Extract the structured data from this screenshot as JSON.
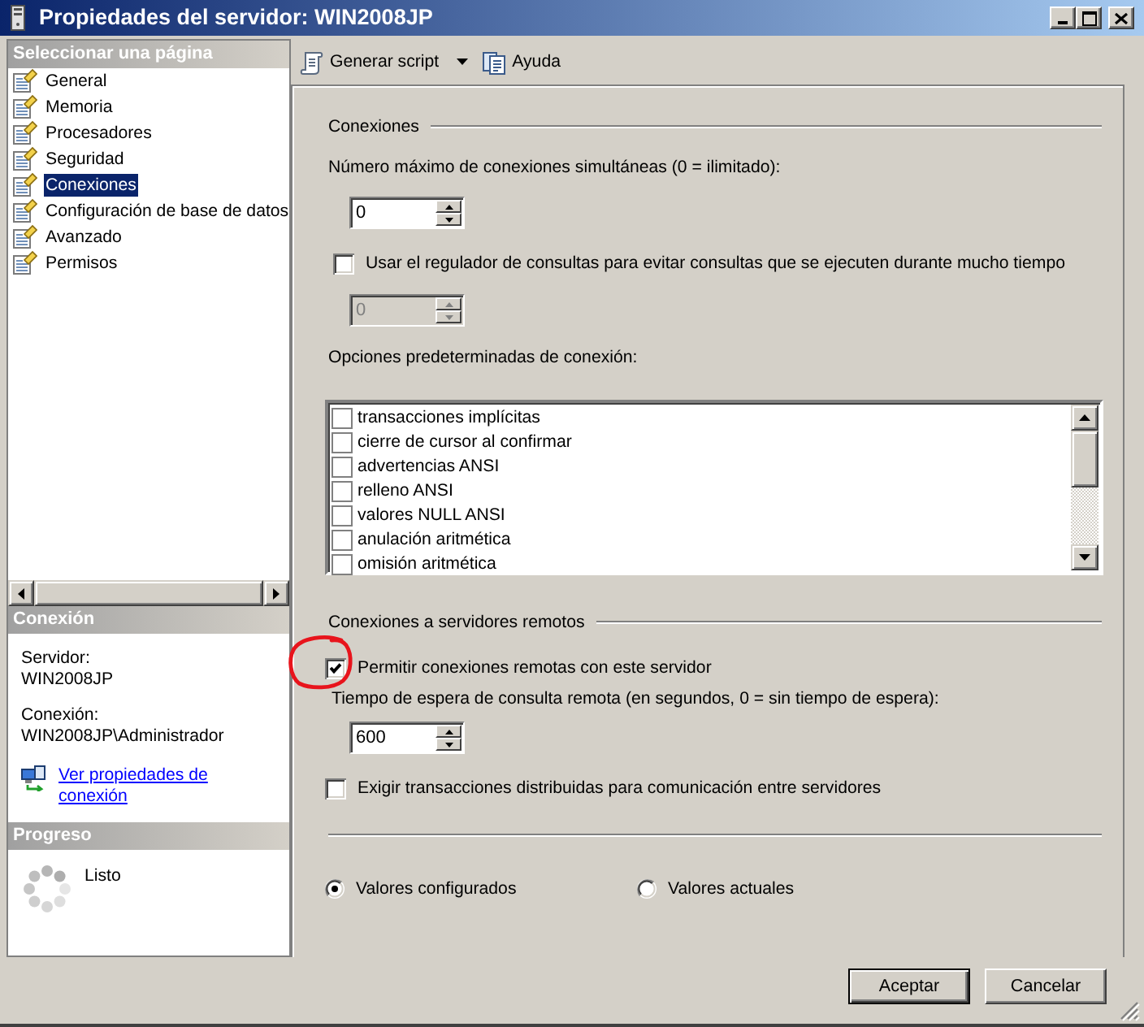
{
  "window": {
    "title": "Propiedades del servidor: WIN2008JP"
  },
  "page_selector": {
    "title": "Seleccionar una página",
    "items": [
      {
        "label": "General",
        "selected": false
      },
      {
        "label": "Memoria",
        "selected": false
      },
      {
        "label": "Procesadores",
        "selected": false
      },
      {
        "label": "Seguridad",
        "selected": false
      },
      {
        "label": "Conexiones",
        "selected": true
      },
      {
        "label": "Configuración de base de datos",
        "selected": false
      },
      {
        "label": "Avanzado",
        "selected": false
      },
      {
        "label": "Permisos",
        "selected": false
      }
    ]
  },
  "connection_info": {
    "title": "Conexión",
    "server_label": "Servidor:",
    "server": "WIN2008JP",
    "user_label": "Conexión:",
    "user": "WIN2008JP\\Administrador",
    "link": "Ver propiedades de conexión"
  },
  "progress": {
    "title": "Progreso",
    "status": "Listo"
  },
  "toolbar": [
    {
      "kind": "script",
      "label": "Generar script"
    },
    {
      "kind": "help",
      "label": "Ayuda"
    }
  ],
  "connections": {
    "title": "Conexiones",
    "max_label": "Número máximo de conexiones simultáneas (0 = ilimitado):",
    "max_value": {
      "value": "0",
      "disabled": false
    },
    "governor": {
      "label": "Usar el regulador de consultas para evitar consultas que se ejecuten durante mucho tiempo",
      "checked": false
    },
    "governor_value": {
      "value": "0",
      "disabled": true
    },
    "defaults_label": "Opciones predeterminadas de conexión:",
    "defaults": [
      {
        "label": "transacciones implícitas",
        "checked": false
      },
      {
        "label": "cierre de cursor al confirmar",
        "checked": false
      },
      {
        "label": "advertencias ANSI",
        "checked": false
      },
      {
        "label": "relleno ANSI",
        "checked": false
      },
      {
        "label": "valores NULL ANSI",
        "checked": false
      },
      {
        "label": "anulación aritmética",
        "checked": false
      },
      {
        "label": "omisión aritmética",
        "checked": false
      }
    ]
  },
  "remote": {
    "title": "Conexiones a servidores remotos",
    "allow": {
      "label": "Permitir conexiones remotas con este servidor",
      "checked": true,
      "circled": true
    },
    "timeout_label": "Tiempo de espera de consulta remota (en segundos, 0 = sin tiempo de espera):",
    "timeout_value": {
      "value": "600",
      "disabled": false
    },
    "distributed": {
      "label": "Exigir transacciones distribuidas para comunicación entre servidores",
      "checked": false
    }
  },
  "values_view": [
    {
      "label": "Valores configurados",
      "selected": true
    },
    {
      "label": "Valores actuales",
      "selected": false
    }
  ],
  "buttons": [
    {
      "label": "Aceptar",
      "default": true
    },
    {
      "label": "Cancelar",
      "default": false
    }
  ]
}
